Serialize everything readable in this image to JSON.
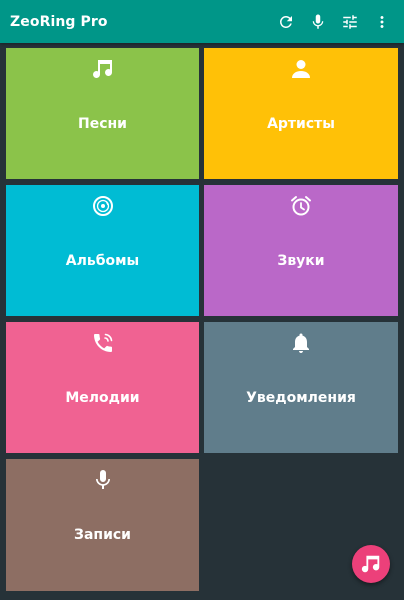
{
  "app": {
    "title": "ZeoRing Pro"
  },
  "toolbar": {
    "actions": [
      {
        "icon": "refresh-icon"
      },
      {
        "icon": "mic-icon"
      },
      {
        "icon": "tune-icon"
      },
      {
        "icon": "more-vert-icon"
      }
    ],
    "color": "#009688"
  },
  "tiles": [
    {
      "label": "Песни",
      "icon": "music-note-icon",
      "color": "#8bc34a"
    },
    {
      "label": "Артисты",
      "icon": "person-icon",
      "color": "#ffc107"
    },
    {
      "label": "Альбомы",
      "icon": "album-icon",
      "color": "#00bcd4"
    },
    {
      "label": "Звуки",
      "icon": "alarm-icon",
      "color": "#ba68c8"
    },
    {
      "label": "Мелодии",
      "icon": "ringing-phone-icon",
      "color": "#f06292"
    },
    {
      "label": "Уведомления",
      "icon": "bell-icon",
      "color": "#607d8b"
    },
    {
      "label": "Записи",
      "icon": "mic-icon",
      "color": "#8d6e63"
    }
  ],
  "fab": {
    "icon": "music-note-icon",
    "color": "#ec407a"
  }
}
